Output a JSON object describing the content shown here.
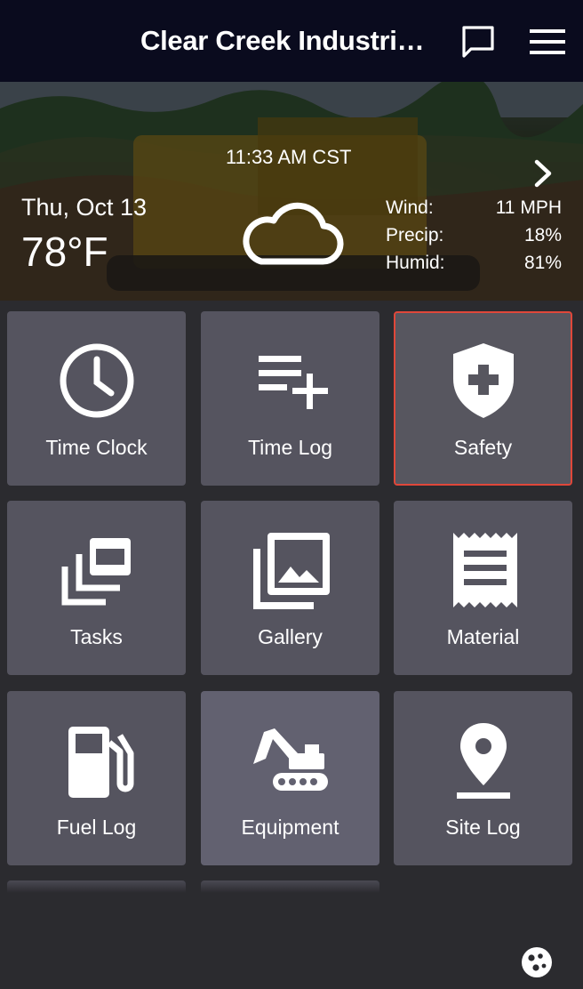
{
  "header": {
    "title": "Clear Creek Industria...",
    "icons": [
      "message-icon",
      "menu-icon"
    ]
  },
  "weather": {
    "time": "11:33 AM CST",
    "date": "Thu, Oct 13",
    "temperature": "78°F",
    "condition_icon": "cloud-icon",
    "wind_label": "Wind:",
    "wind_value": "11 MPH",
    "precip_label": "Precip:",
    "precip_value": "18%",
    "humid_label": "Humid:",
    "humid_value": "81%"
  },
  "tiles": [
    {
      "label": "Time Clock",
      "icon": "clock-icon"
    },
    {
      "label": "Time Log",
      "icon": "playlist-add-icon"
    },
    {
      "label": "Safety",
      "icon": "shield-plus-icon",
      "state": "selected"
    },
    {
      "label": "Tasks",
      "icon": "layered-windows-icon"
    },
    {
      "label": "Gallery",
      "icon": "photo-library-icon"
    },
    {
      "label": "Material",
      "icon": "receipt-icon"
    },
    {
      "label": "Fuel Log",
      "icon": "fuel-pump-icon"
    },
    {
      "label": "Equipment",
      "icon": "excavator-icon",
      "state": "hover"
    },
    {
      "label": "Site Log",
      "icon": "location-pin-icon"
    }
  ],
  "colors": {
    "topbar": "#0a0b1e",
    "background": "#2b2b2f",
    "tile": "#55545f",
    "selected_border": "#e0473a"
  },
  "fab_icon": "cookie-icon"
}
